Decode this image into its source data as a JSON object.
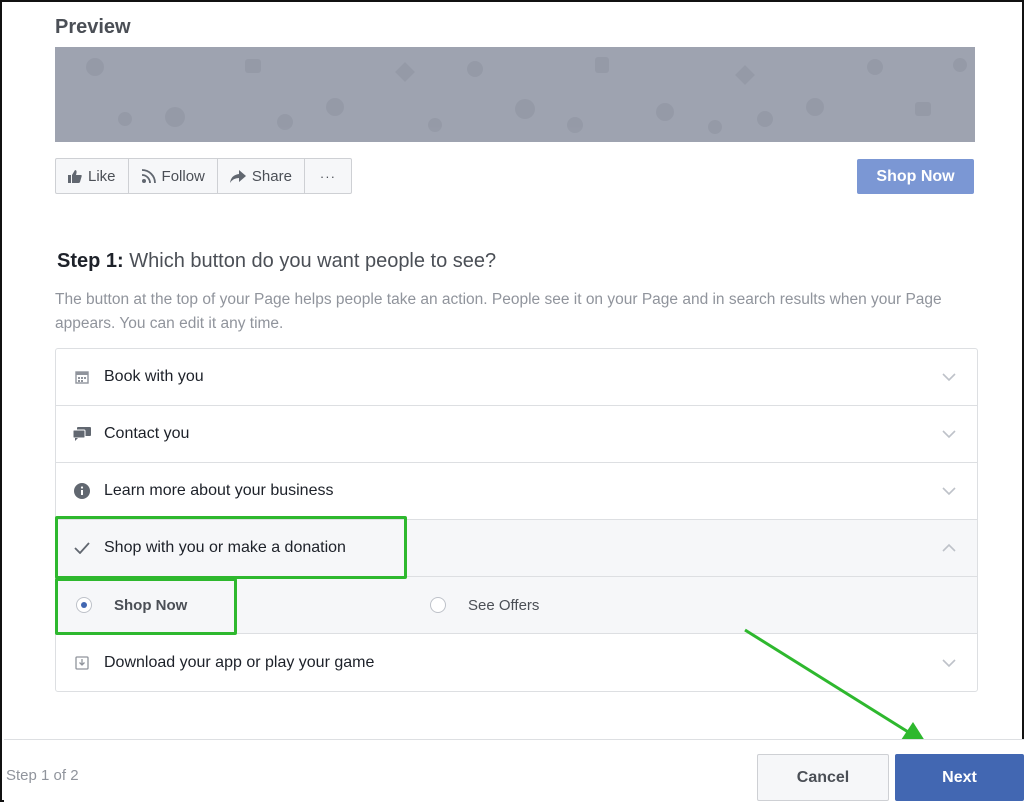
{
  "preview": {
    "title": "Preview"
  },
  "action_bar": {
    "items": [
      {
        "label": "Like",
        "icon": "thumbs-up-icon"
      },
      {
        "label": "Follow",
        "icon": "rss-icon"
      },
      {
        "label": "Share",
        "icon": "share-arrow-icon"
      },
      {
        "label": "···",
        "icon": "more-icon"
      }
    ],
    "cta_label": "Shop Now"
  },
  "step": {
    "number": "Step 1:",
    "question": "Which button do you want people to see?",
    "description": "The button at the top of your Page helps people take an action. People see it on your Page and in search results when your Page appears. You can edit it any time."
  },
  "options": [
    {
      "label": "Book with you",
      "icon": "calendar-icon",
      "expanded": false
    },
    {
      "label": "Contact you",
      "icon": "chat-bubbles-icon",
      "expanded": false
    },
    {
      "label": "Learn more about your business",
      "icon": "info-icon",
      "expanded": false
    },
    {
      "label": "Shop with you or make a donation",
      "icon": "checkmark-icon",
      "expanded": true,
      "choices": [
        {
          "label": "Shop Now",
          "selected": true
        },
        {
          "label": "See Offers",
          "selected": false
        }
      ]
    },
    {
      "label": "Download your app or play your game",
      "icon": "download-icon",
      "expanded": false
    }
  ],
  "footer": {
    "step_count": "Step 1 of 2",
    "cancel_label": "Cancel",
    "next_label": "Next"
  },
  "colors": {
    "primary": "#4267b2",
    "cta_preview": "#7b97d4",
    "highlight": "#2eb82e"
  }
}
